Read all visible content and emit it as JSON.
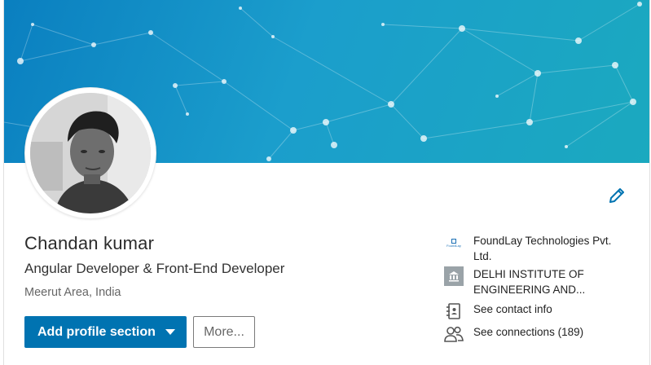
{
  "profile": {
    "name": "Chandan kumar",
    "headline": "Angular Developer & Front-End Developer",
    "location": "Meerut Area, India"
  },
  "actions": {
    "add_profile_section": "Add profile section",
    "more": "More..."
  },
  "sidebar": {
    "company": {
      "name": "FoundLay Technologies Pvt. Ltd.",
      "icon": "company-logo-icon"
    },
    "school": {
      "name": "DELHI INSTITUTE OF ENGINEERING AND...",
      "icon": "school-icon"
    },
    "contact": {
      "label": "See contact info",
      "icon": "contact-book-icon"
    },
    "connections": {
      "label": "See connections (189)",
      "icon": "people-icon"
    }
  },
  "icons": {
    "edit": "pencil-icon",
    "dropdown": "caret-down-icon"
  },
  "colors": {
    "primary_button": "#0073b1",
    "banner_start": "#0a7fc0",
    "banner_end": "#1ba9bf"
  }
}
